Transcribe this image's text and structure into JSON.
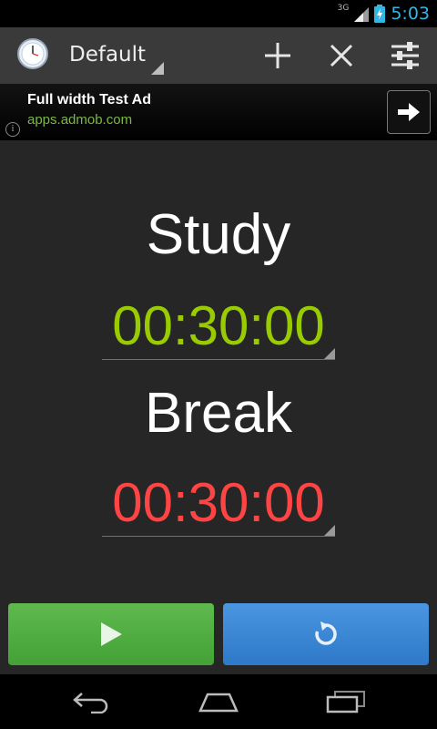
{
  "status_bar": {
    "network_type": "3G",
    "time": "5:03",
    "signal_icon": "signal-icon",
    "battery_icon": "battery-charging-icon"
  },
  "action_bar": {
    "app_icon": "stopwatch-icon",
    "profile_selected": "Default",
    "actions": [
      "add-icon",
      "close-icon",
      "settings-sliders-icon"
    ]
  },
  "ad": {
    "title": "Full width Test Ad",
    "url": "apps.admob.com",
    "info_glyph": "i",
    "arrow_icon": "arrow-right-icon"
  },
  "timers": {
    "study": {
      "label": "Study",
      "value": "00:30:00",
      "color": "#99cc00"
    },
    "break": {
      "label": "Break",
      "value": "00:30:00",
      "color": "#ff4444"
    }
  },
  "controls": {
    "start_icon": "play-icon",
    "start_color": "#4fae3f",
    "reset_icon": "reset-icon",
    "reset_color": "#3a88d6"
  },
  "nav_bar": [
    "back-icon",
    "home-icon",
    "recent-apps-icon"
  ]
}
